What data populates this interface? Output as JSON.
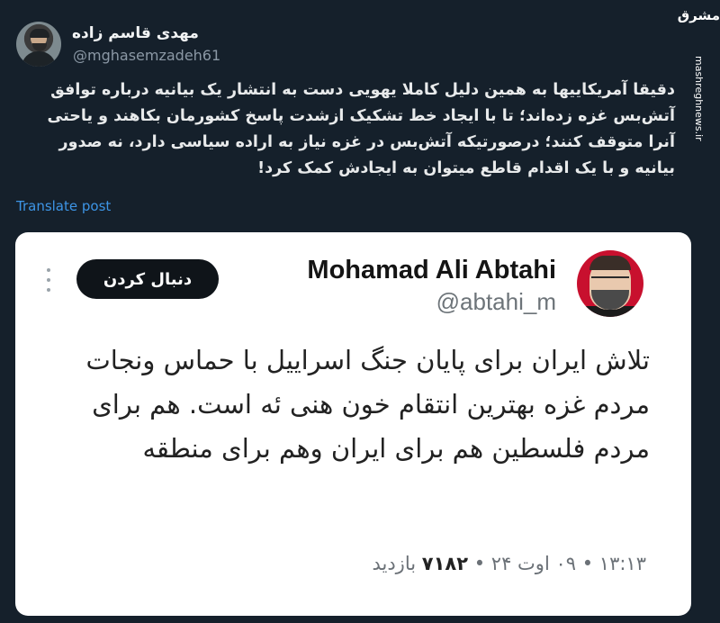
{
  "tweet": {
    "display_name": "مهدی قاسم زاده",
    "handle": "@mghasemzadeh61",
    "text": "دقیقا آمریکاییها به همین دلیل کاملا یهویی دست به انتشار یک بیانیه درباره توافق آتش‌بس غزه زده‌اند؛ تا با ایجاد خط تشکیک ازشدت پاسخ کشورمان بکاهند و یاحتی آنرا متوقف کنند؛ درصورتیکه آتش‌بس در غزه نیاز به اراده سیاسی دارد، نه صدور بیانیه و با یک اقدام قاطع میتوان به ایجادش کمک کرد!",
    "translate_label": "Translate post"
  },
  "quoted": {
    "display_name": "Mohamad Ali Abtahi",
    "handle": "@abtahi_m",
    "follow_label": "دنبال کردن",
    "text": "تلاش ایران برای پایان جنگ اسراییل با حماس ونجات مردم غزه بهترین انتقام خون هنی ئه است. هم برای مردم فلسطین هم برای ایران وهم برای منطقه",
    "time": "۱۳:۱۳",
    "date": "۰۹ اوت ۲۴",
    "views": "۷۱۸۲",
    "views_label": "بازدید",
    "separator": "•"
  },
  "watermark": {
    "logo": "مشرق",
    "url": "mashreghnews.ir"
  },
  "colors": {
    "background": "#15202b",
    "link": "#3d95e6",
    "card": "#ffffff",
    "follow_button": "#0f1419"
  },
  "icons": [
    "user-avatar",
    "more-options-icon",
    "mashregh-logo"
  ]
}
